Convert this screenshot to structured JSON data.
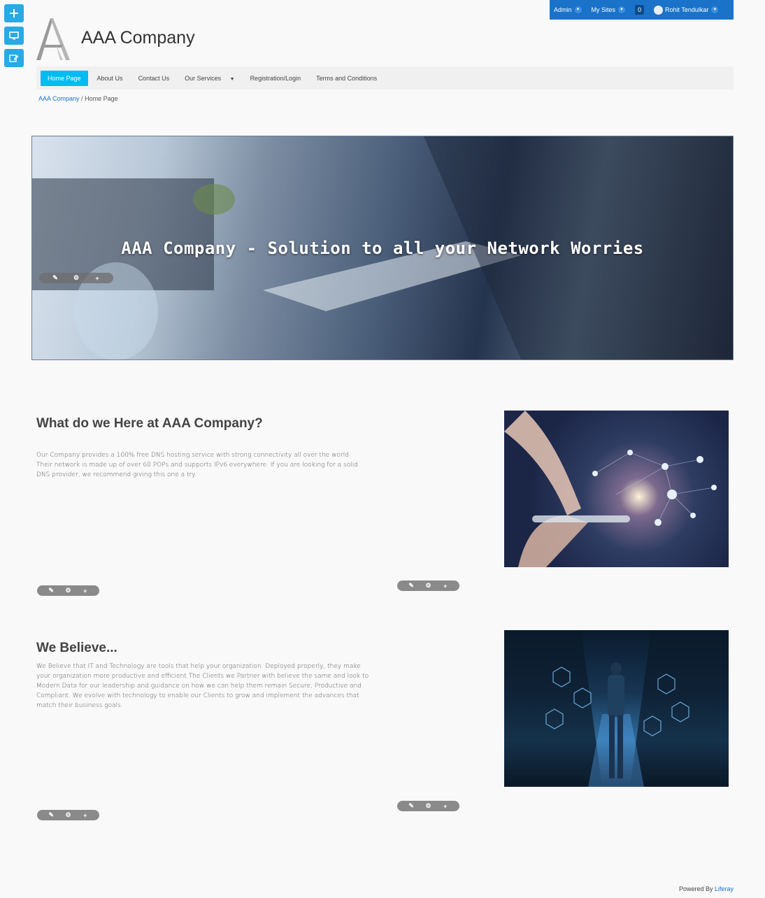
{
  "adminbar": {
    "admin_label": "Admin",
    "mysites_label": "My Sites",
    "notifications_count": "0",
    "user_name": "Rohit Tendulkar"
  },
  "header": {
    "brand": "AAA Company"
  },
  "nav": {
    "items": [
      {
        "label": "Home Page"
      },
      {
        "label": "About Us"
      },
      {
        "label": "Contact Us"
      },
      {
        "label": "Our Services"
      },
      {
        "label": "Registration/Login"
      },
      {
        "label": "Terms and Conditions"
      }
    ]
  },
  "breadcrumb": {
    "root": "AAA Company",
    "separator": "/",
    "current": "Home Page"
  },
  "hero": {
    "title": "AAA Company - Solution to all your Network Worries"
  },
  "sections": [
    {
      "title": "What do we Here at AAA Company?",
      "text": "Our Company provides a 100% free DNS hosting service with strong connectivity all over the world. Their network is made up of over 60 POPs and supports IPv6 everywhere. If you are looking for a solid DNS provider, we recommend giving this one a try."
    },
    {
      "title": "We Believe...",
      "text": "We Believe that IT and Technology are tools that help your organization. Deployed properly, they make your organization more productive and efficient The Clients we Partner with believe the same and look to Modern Data for our leadership and guidance on how we can help them remain Secure, Productive and Compliant. We evolve with technology to enable our Clients to grow and implement the advances that match their business goals."
    }
  ],
  "footer": {
    "powered_by": "Powered By",
    "link": "Liferay"
  },
  "colors": {
    "accent": "#00bcf2",
    "adminbar": "#1a73c9",
    "dock": "#29a9e5"
  }
}
